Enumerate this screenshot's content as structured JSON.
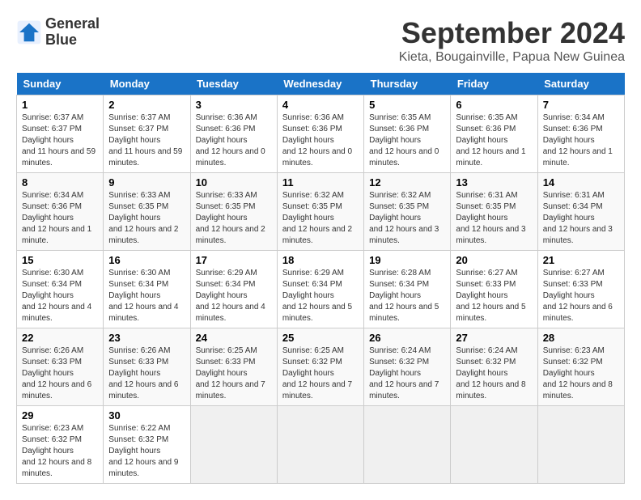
{
  "header": {
    "logo_line1": "General",
    "logo_line2": "Blue",
    "month_title": "September 2024",
    "location": "Kieta, Bougainville, Papua New Guinea"
  },
  "weekdays": [
    "Sunday",
    "Monday",
    "Tuesday",
    "Wednesday",
    "Thursday",
    "Friday",
    "Saturday"
  ],
  "weeks": [
    [
      {
        "day": "1",
        "sunrise": "6:37 AM",
        "sunset": "6:37 PM",
        "daylight": "11 hours and 59 minutes."
      },
      {
        "day": "2",
        "sunrise": "6:37 AM",
        "sunset": "6:37 PM",
        "daylight": "11 hours and 59 minutes."
      },
      {
        "day": "3",
        "sunrise": "6:36 AM",
        "sunset": "6:36 PM",
        "daylight": "12 hours and 0 minutes."
      },
      {
        "day": "4",
        "sunrise": "6:36 AM",
        "sunset": "6:36 PM",
        "daylight": "12 hours and 0 minutes."
      },
      {
        "day": "5",
        "sunrise": "6:35 AM",
        "sunset": "6:36 PM",
        "daylight": "12 hours and 0 minutes."
      },
      {
        "day": "6",
        "sunrise": "6:35 AM",
        "sunset": "6:36 PM",
        "daylight": "12 hours and 1 minute."
      },
      {
        "day": "7",
        "sunrise": "6:34 AM",
        "sunset": "6:36 PM",
        "daylight": "12 hours and 1 minute."
      }
    ],
    [
      {
        "day": "8",
        "sunrise": "6:34 AM",
        "sunset": "6:36 PM",
        "daylight": "12 hours and 1 minute."
      },
      {
        "day": "9",
        "sunrise": "6:33 AM",
        "sunset": "6:35 PM",
        "daylight": "12 hours and 2 minutes."
      },
      {
        "day": "10",
        "sunrise": "6:33 AM",
        "sunset": "6:35 PM",
        "daylight": "12 hours and 2 minutes."
      },
      {
        "day": "11",
        "sunrise": "6:32 AM",
        "sunset": "6:35 PM",
        "daylight": "12 hours and 2 minutes."
      },
      {
        "day": "12",
        "sunrise": "6:32 AM",
        "sunset": "6:35 PM",
        "daylight": "12 hours and 3 minutes."
      },
      {
        "day": "13",
        "sunrise": "6:31 AM",
        "sunset": "6:35 PM",
        "daylight": "12 hours and 3 minutes."
      },
      {
        "day": "14",
        "sunrise": "6:31 AM",
        "sunset": "6:34 PM",
        "daylight": "12 hours and 3 minutes."
      }
    ],
    [
      {
        "day": "15",
        "sunrise": "6:30 AM",
        "sunset": "6:34 PM",
        "daylight": "12 hours and 4 minutes."
      },
      {
        "day": "16",
        "sunrise": "6:30 AM",
        "sunset": "6:34 PM",
        "daylight": "12 hours and 4 minutes."
      },
      {
        "day": "17",
        "sunrise": "6:29 AM",
        "sunset": "6:34 PM",
        "daylight": "12 hours and 4 minutes."
      },
      {
        "day": "18",
        "sunrise": "6:29 AM",
        "sunset": "6:34 PM",
        "daylight": "12 hours and 5 minutes."
      },
      {
        "day": "19",
        "sunrise": "6:28 AM",
        "sunset": "6:34 PM",
        "daylight": "12 hours and 5 minutes."
      },
      {
        "day": "20",
        "sunrise": "6:27 AM",
        "sunset": "6:33 PM",
        "daylight": "12 hours and 5 minutes."
      },
      {
        "day": "21",
        "sunrise": "6:27 AM",
        "sunset": "6:33 PM",
        "daylight": "12 hours and 6 minutes."
      }
    ],
    [
      {
        "day": "22",
        "sunrise": "6:26 AM",
        "sunset": "6:33 PM",
        "daylight": "12 hours and 6 minutes."
      },
      {
        "day": "23",
        "sunrise": "6:26 AM",
        "sunset": "6:33 PM",
        "daylight": "12 hours and 6 minutes."
      },
      {
        "day": "24",
        "sunrise": "6:25 AM",
        "sunset": "6:33 PM",
        "daylight": "12 hours and 7 minutes."
      },
      {
        "day": "25",
        "sunrise": "6:25 AM",
        "sunset": "6:32 PM",
        "daylight": "12 hours and 7 minutes."
      },
      {
        "day": "26",
        "sunrise": "6:24 AM",
        "sunset": "6:32 PM",
        "daylight": "12 hours and 7 minutes."
      },
      {
        "day": "27",
        "sunrise": "6:24 AM",
        "sunset": "6:32 PM",
        "daylight": "12 hours and 8 minutes."
      },
      {
        "day": "28",
        "sunrise": "6:23 AM",
        "sunset": "6:32 PM",
        "daylight": "12 hours and 8 minutes."
      }
    ],
    [
      {
        "day": "29",
        "sunrise": "6:23 AM",
        "sunset": "6:32 PM",
        "daylight": "12 hours and 8 minutes."
      },
      {
        "day": "30",
        "sunrise": "6:22 AM",
        "sunset": "6:32 PM",
        "daylight": "12 hours and 9 minutes."
      },
      null,
      null,
      null,
      null,
      null
    ]
  ]
}
